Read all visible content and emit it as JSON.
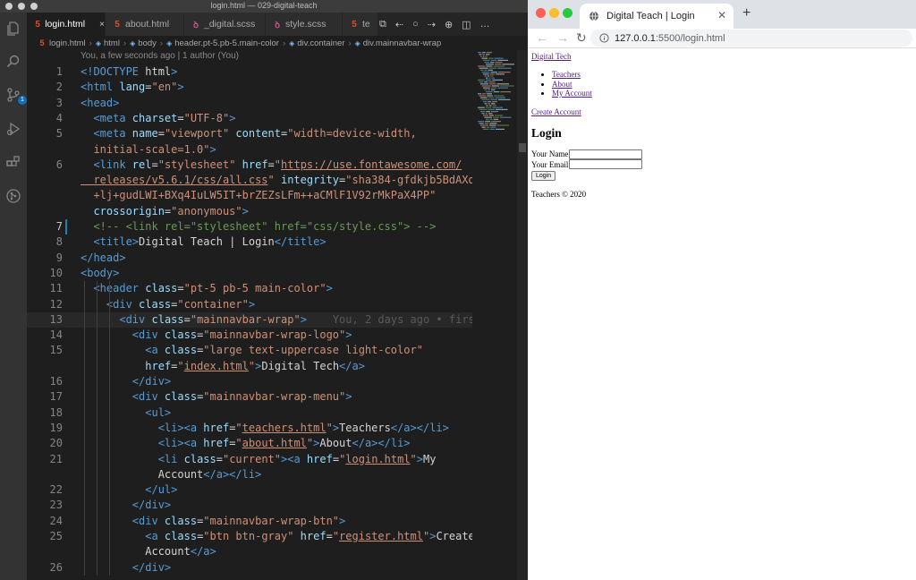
{
  "vscode": {
    "window_title": "login.html — 029-digital-teach",
    "tabs": [
      {
        "label": "login.html",
        "icon": "html5-icon",
        "active": true
      },
      {
        "label": "about.html",
        "icon": "html5-icon",
        "active": false
      },
      {
        "label": "_digital.scss",
        "icon": "sass-icon",
        "active": false
      },
      {
        "label": "style.scss",
        "icon": "sass-icon",
        "active": false
      },
      {
        "label": "te",
        "icon": "html5-icon",
        "active": false
      }
    ],
    "breadcrumb": [
      "login.html",
      "html",
      "body",
      "header.pt-5.pb-5.main-color",
      "div.container",
      "div.mainnavbar-wrap"
    ],
    "scm_badge": "1",
    "blame_header": "You, a few seconds ago | 1 author (You)",
    "inline_blame": "You, 2 days ago • firs",
    "lines": [
      {
        "n": "1",
        "seg": [
          [
            "doc",
            "<!"
          ],
          [
            "doc",
            "DOCTYPE"
          ],
          [
            "txt",
            " html"
          ],
          [
            "doc",
            ">"
          ]
        ]
      },
      {
        "n": "2",
        "seg": [
          [
            "tag",
            "<html"
          ],
          [
            "attr",
            " lang"
          ],
          [
            "txt",
            "="
          ],
          [
            "str",
            "\"en\""
          ],
          [
            "tag",
            ">"
          ]
        ]
      },
      {
        "n": "3",
        "seg": [
          [
            "tag",
            "<head>"
          ]
        ]
      },
      {
        "n": "4",
        "seg": [
          [
            "txt",
            "  "
          ],
          [
            "tag",
            "<meta"
          ],
          [
            "attr",
            " charset"
          ],
          [
            "txt",
            "="
          ],
          [
            "str",
            "\"UTF-8\""
          ],
          [
            "tag",
            ">"
          ]
        ]
      },
      {
        "n": "5",
        "seg": [
          [
            "txt",
            "  "
          ],
          [
            "tag",
            "<meta"
          ],
          [
            "attr",
            " name"
          ],
          [
            "txt",
            "="
          ],
          [
            "str",
            "\"viewport\""
          ],
          [
            "attr",
            " content"
          ],
          [
            "txt",
            "="
          ],
          [
            "str",
            "\"width=device-width,"
          ]
        ]
      },
      {
        "n": "",
        "seg": [
          [
            "str",
            "  initial-scale=1.0\""
          ],
          [
            "tag",
            ">"
          ]
        ]
      },
      {
        "n": "6",
        "seg": [
          [
            "txt",
            "  "
          ],
          [
            "tag",
            "<link"
          ],
          [
            "attr",
            " rel"
          ],
          [
            "txt",
            "="
          ],
          [
            "str",
            "\"stylesheet\""
          ],
          [
            "attr",
            " href"
          ],
          [
            "txt",
            "="
          ],
          [
            "str",
            "\""
          ],
          [
            "url",
            "https://use.fontawesome.com/"
          ]
        ]
      },
      {
        "n": "",
        "seg": [
          [
            "url",
            "  releases/v5.6.1/css/all.css"
          ],
          [
            "str",
            "\""
          ],
          [
            "attr",
            " integrity"
          ],
          [
            "txt",
            "="
          ],
          [
            "str",
            "\"sha384-gfdkjb5BdAXd"
          ]
        ]
      },
      {
        "n": "",
        "seg": [
          [
            "str",
            "  +lj+gudLWI+BXq4IuLW5IT+brZEZsLFm++aCMlF1V92rMkPaX4PP\""
          ]
        ]
      },
      {
        "n": "",
        "seg": [
          [
            "attr",
            "  crossorigin"
          ],
          [
            "txt",
            "="
          ],
          [
            "str",
            "\"anonymous\""
          ],
          [
            "tag",
            ">"
          ]
        ]
      },
      {
        "n": "7",
        "seg": [
          [
            "cmt",
            "  <!-- <link rel=\"stylesheet\" href=\"css/style.css\"> -->"
          ]
        ]
      },
      {
        "n": "8",
        "seg": [
          [
            "txt",
            "  "
          ],
          [
            "tag",
            "<title>"
          ],
          [
            "txt",
            "Digital Teach | Login"
          ],
          [
            "tag",
            "</title>"
          ]
        ]
      },
      {
        "n": "9",
        "seg": [
          [
            "tag",
            "</head>"
          ]
        ]
      },
      {
        "n": "10",
        "seg": [
          [
            "tag",
            "<body>"
          ]
        ]
      },
      {
        "n": "11",
        "seg": [
          [
            "txt",
            "  "
          ],
          [
            "tag",
            "<header"
          ],
          [
            "attr",
            " class"
          ],
          [
            "txt",
            "="
          ],
          [
            "str",
            "\"pt-5 pb-5 main-color\""
          ],
          [
            "tag",
            ">"
          ]
        ]
      },
      {
        "n": "12",
        "seg": [
          [
            "txt",
            "    "
          ],
          [
            "tag",
            "<div"
          ],
          [
            "attr",
            " class"
          ],
          [
            "txt",
            "="
          ],
          [
            "str",
            "\"container\""
          ],
          [
            "tag",
            ">"
          ]
        ]
      },
      {
        "n": "13",
        "seg": [
          [
            "txt",
            "      "
          ],
          [
            "tag",
            "<div"
          ],
          [
            "attr",
            " class"
          ],
          [
            "txt",
            "="
          ],
          [
            "str",
            "\"mainnavbar-wrap\""
          ],
          [
            "tag",
            ">"
          ],
          [
            "ghost",
            "    You, 2 days ago • firs"
          ]
        ]
      },
      {
        "n": "14",
        "seg": [
          [
            "txt",
            "        "
          ],
          [
            "tag",
            "<div"
          ],
          [
            "attr",
            " class"
          ],
          [
            "txt",
            "="
          ],
          [
            "str",
            "\"mainnavbar-wrap-logo\""
          ],
          [
            "tag",
            ">"
          ]
        ]
      },
      {
        "n": "15",
        "seg": [
          [
            "txt",
            "          "
          ],
          [
            "tag",
            "<a"
          ],
          [
            "attr",
            " class"
          ],
          [
            "txt",
            "="
          ],
          [
            "str",
            "\"large text-uppercase light-color\""
          ]
        ]
      },
      {
        "n": "",
        "seg": [
          [
            "attr",
            "          href"
          ],
          [
            "txt",
            "="
          ],
          [
            "str",
            "\""
          ],
          [
            "url",
            "index.html"
          ],
          [
            "str",
            "\""
          ],
          [
            "tag",
            ">"
          ],
          [
            "txt",
            "Digital Tech"
          ],
          [
            "tag",
            "</a>"
          ]
        ]
      },
      {
        "n": "16",
        "seg": [
          [
            "txt",
            "        "
          ],
          [
            "tag",
            "</div>"
          ]
        ]
      },
      {
        "n": "17",
        "seg": [
          [
            "txt",
            "        "
          ],
          [
            "tag",
            "<div"
          ],
          [
            "attr",
            " class"
          ],
          [
            "txt",
            "="
          ],
          [
            "str",
            "\"mainnavbar-wrap-menu\""
          ],
          [
            "tag",
            ">"
          ]
        ]
      },
      {
        "n": "18",
        "seg": [
          [
            "txt",
            "          "
          ],
          [
            "tag",
            "<ul>"
          ]
        ]
      },
      {
        "n": "19",
        "seg": [
          [
            "txt",
            "            "
          ],
          [
            "tag",
            "<li><a"
          ],
          [
            "attr",
            " href"
          ],
          [
            "txt",
            "="
          ],
          [
            "str",
            "\""
          ],
          [
            "url",
            "teachers.html"
          ],
          [
            "str",
            "\""
          ],
          [
            "tag",
            ">"
          ],
          [
            "txt",
            "Teachers"
          ],
          [
            "tag",
            "</a></li>"
          ]
        ]
      },
      {
        "n": "20",
        "seg": [
          [
            "txt",
            "            "
          ],
          [
            "tag",
            "<li><a"
          ],
          [
            "attr",
            " href"
          ],
          [
            "txt",
            "="
          ],
          [
            "str",
            "\""
          ],
          [
            "url",
            "about.html"
          ],
          [
            "str",
            "\""
          ],
          [
            "tag",
            ">"
          ],
          [
            "txt",
            "About"
          ],
          [
            "tag",
            "</a></li>"
          ]
        ]
      },
      {
        "n": "21",
        "seg": [
          [
            "txt",
            "            "
          ],
          [
            "tag",
            "<li"
          ],
          [
            "attr",
            " class"
          ],
          [
            "txt",
            "="
          ],
          [
            "str",
            "\"current\""
          ],
          [
            "tag",
            "><a"
          ],
          [
            "attr",
            " href"
          ],
          [
            "txt",
            "="
          ],
          [
            "str",
            "\""
          ],
          [
            "url",
            "login.html"
          ],
          [
            "str",
            "\""
          ],
          [
            "tag",
            ">"
          ],
          [
            "txt",
            "My"
          ]
        ]
      },
      {
        "n": "",
        "seg": [
          [
            "txt",
            "            Account"
          ],
          [
            "tag",
            "</a></li>"
          ]
        ]
      },
      {
        "n": "22",
        "seg": [
          [
            "txt",
            "          "
          ],
          [
            "tag",
            "</ul>"
          ]
        ]
      },
      {
        "n": "23",
        "seg": [
          [
            "txt",
            "        "
          ],
          [
            "tag",
            "</div>"
          ]
        ]
      },
      {
        "n": "24",
        "seg": [
          [
            "txt",
            "        "
          ],
          [
            "tag",
            "<div"
          ],
          [
            "attr",
            " class"
          ],
          [
            "txt",
            "="
          ],
          [
            "str",
            "\"mainnavbar-wrap-btn\""
          ],
          [
            "tag",
            ">"
          ]
        ]
      },
      {
        "n": "25",
        "seg": [
          [
            "txt",
            "          "
          ],
          [
            "tag",
            "<a"
          ],
          [
            "attr",
            " class"
          ],
          [
            "txt",
            "="
          ],
          [
            "str",
            "\"btn btn-gray\""
          ],
          [
            "attr",
            " href"
          ],
          [
            "txt",
            "="
          ],
          [
            "str",
            "\""
          ],
          [
            "url",
            "register.html"
          ],
          [
            "str",
            "\""
          ],
          [
            "tag",
            ">"
          ],
          [
            "txt",
            "Create"
          ]
        ]
      },
      {
        "n": "",
        "seg": [
          [
            "txt",
            "          Account"
          ],
          [
            "tag",
            "</a>"
          ]
        ]
      },
      {
        "n": "26",
        "seg": [
          [
            "txt",
            "        "
          ],
          [
            "tag",
            "</div>"
          ]
        ]
      }
    ],
    "colors": {
      "tag": "#569cd6",
      "attr": "#9cdcfe",
      "string": "#ce9178",
      "comment": "#6a9955",
      "git_modified": "#1b81a8"
    }
  },
  "browser": {
    "tab_title": "Digital Teach | Login",
    "url_host": "127.0.0.1",
    "url_path": ":5500/login.html",
    "page": {
      "logo_link": "Digital Tech",
      "nav": [
        "Teachers",
        "About",
        "My Account"
      ],
      "create_account_link": "Create Account",
      "heading": "Login",
      "name_label": "Your Name",
      "email_label": "Your Email",
      "name_value": "",
      "email_value": "",
      "login_button": "Login",
      "footer": "Teachers © 2020"
    }
  }
}
